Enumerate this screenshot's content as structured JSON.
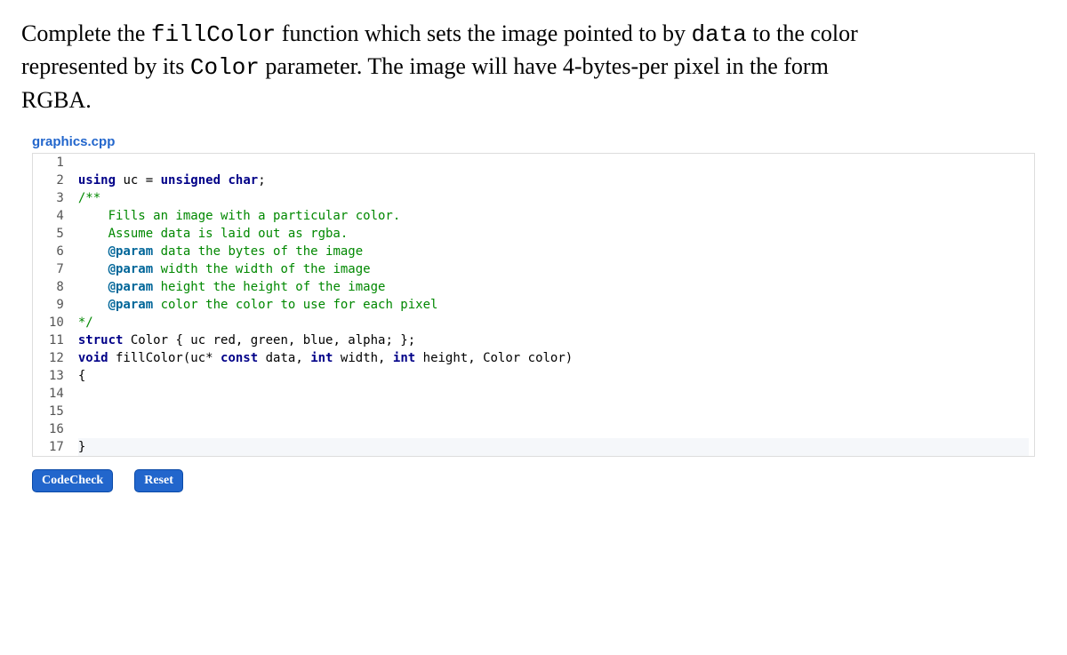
{
  "instructions": {
    "part1": "Complete the ",
    "code1": "fillColor",
    "part2": " function which sets the image pointed to by ",
    "code2": "data",
    "part3": " to the color represented by its ",
    "code3": "Color",
    "part4": " parameter. The image will have 4-bytes-per pixel in the form RGBA."
  },
  "filename": "graphics.cpp",
  "code": {
    "lines": [
      "",
      "using uc = unsigned char;",
      "/**",
      "    Fills an image with a particular color.",
      "    Assume data is laid out as rgba.",
      "    @param data the bytes of the image",
      "    @param width the width of the image",
      "    @param height the height of the image",
      "    @param color the color to use for each pixel",
      "*/",
      "struct Color { uc red, green, blue, alpha; };",
      "void fillColor(uc* const data, int width, int height, Color color)",
      "{",
      "",
      "",
      "",
      "}"
    ]
  },
  "buttons": {
    "check": "CodeCheck",
    "reset": "Reset"
  }
}
